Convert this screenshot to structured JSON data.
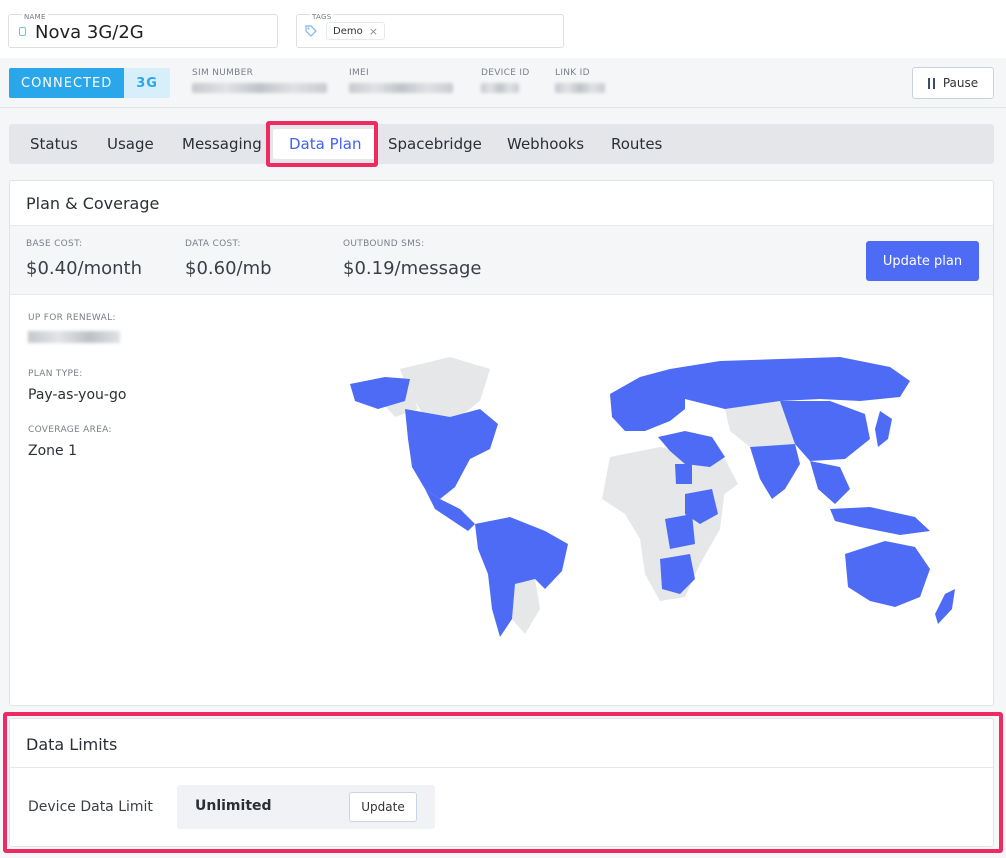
{
  "header": {
    "name_label": "NAME",
    "name_value": "Nova 3G/2G",
    "tags_label": "TAGS",
    "tags": [
      "Demo"
    ],
    "tag_remove_glyph": "×"
  },
  "status": {
    "connection": "CONNECTED",
    "network": "3G",
    "sim_label": "SIM NUMBER",
    "imei_label": "IMEI",
    "device_id_label": "DEVICE ID",
    "link_id_label": "LINK ID",
    "pause_label": "Pause"
  },
  "tabs": [
    {
      "label": "Status"
    },
    {
      "label": "Usage"
    },
    {
      "label": "Messaging"
    },
    {
      "label": "Data Plan",
      "active": true
    },
    {
      "label": "Spacebridge"
    },
    {
      "label": "Webhooks"
    },
    {
      "label": "Routes"
    }
  ],
  "plan": {
    "title": "Plan & Coverage",
    "base_cost_label": "BASE COST:",
    "base_cost_value": "$0.40/month",
    "data_cost_label": "DATA COST:",
    "data_cost_value": "$0.60/mb",
    "sms_label": "OUTBOUND SMS:",
    "sms_value": "$0.19/message",
    "update_plan_label": "Update plan",
    "renewal_label": "UP FOR RENEWAL:",
    "plan_type_label": "PLAN TYPE:",
    "plan_type_value": "Pay-as-you-go",
    "coverage_label": "COVERAGE AREA:",
    "coverage_value": "Zone 1"
  },
  "limits": {
    "title": "Data Limits",
    "device_limit_label": "Device Data Limit",
    "device_limit_value": "Unlimited",
    "update_label": "Update"
  },
  "colors": {
    "accent": "#4d6bf5",
    "connected": "#2aa7ea",
    "highlight": "#ee2a63",
    "coverage": "#4d6bf5",
    "no_coverage": "#e6e7e9"
  }
}
